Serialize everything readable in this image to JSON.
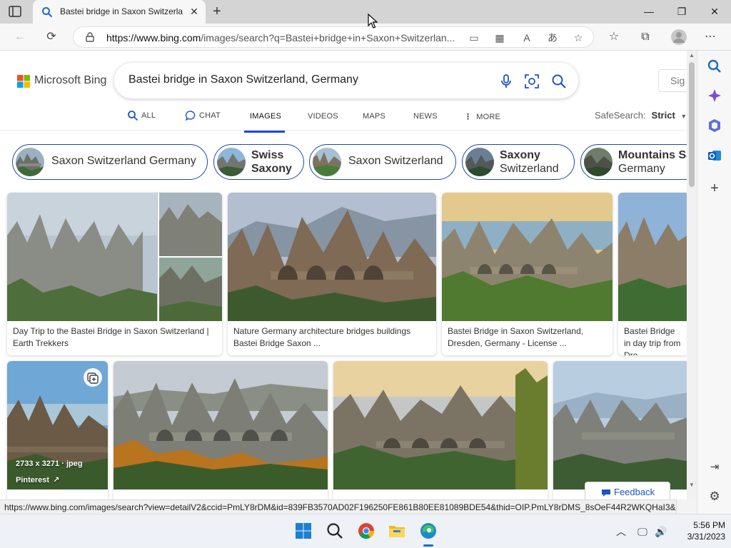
{
  "browser": {
    "tab_title": "Bastei bridge in Saxon Switzerlan",
    "url_prefix": "https://www.bing.com",
    "url_rest": "/images/search?q=Bastei+bridge+in+Saxon+Switzerlan..."
  },
  "bing": {
    "logo_text": "Microsoft Bing",
    "query": "Bastei bridge in Saxon Switzerland, Germany",
    "signin": "Sig",
    "nav": [
      {
        "label": "ALL",
        "icon": "search-icon"
      },
      {
        "label": "CHAT",
        "icon": "chat-icon"
      },
      {
        "label": "IMAGES"
      },
      {
        "label": "VIDEOS"
      },
      {
        "label": "MAPS"
      },
      {
        "label": "NEWS"
      },
      {
        "label": "MORE",
        "icon": "more-vertical-icon"
      }
    ],
    "safesearch_label": "SafeSearch:",
    "safesearch_value": "Strict",
    "pills": [
      {
        "label": "Saxon Switzerland Germany"
      },
      {
        "line1": "Swiss",
        "line2": "Saxony"
      },
      {
        "label": "Saxon Switzerland"
      },
      {
        "line1": "Saxony",
        "line2": "Switzerland"
      },
      {
        "line1": "Mountains Sa",
        "line2": "Germany"
      }
    ],
    "row1": [
      {
        "caption": "Day Trip to the Bastei Bridge in Saxon Switzerland | Earth Trekkers"
      },
      {
        "caption": "Nature Germany architecture bridges buildings Bastei Bridge Saxon ..."
      },
      {
        "caption": "Bastei Bridge in Saxon Switzerland, Dresden, Germany - License ..."
      },
      {
        "caption": "Bastei Bridge in day trip from Dre"
      }
    ],
    "row2_meta": {
      "dims": "2733 x 3271 · jpeg",
      "source": "Pinterest"
    },
    "feedback": "Feedback"
  },
  "status_url": "https://www.bing.com/images/search?view=detailV2&ccid=PmLY8rDM&id=839FB3570AD02F196250FE861B80EE81089BDE54&thid=OIP.PmLY8rDMS_8sOeF44R2WKQHaI3&m...",
  "clock": {
    "time": "5:56 PM",
    "date": "3/31/2023"
  },
  "colors": {
    "accent": "#174ae4",
    "pill_border": "#1a4aa8",
    "taskbar": "#eef1f6"
  }
}
